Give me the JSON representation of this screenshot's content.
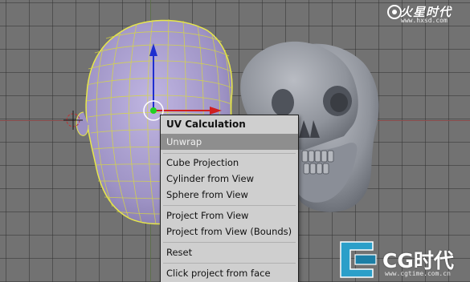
{
  "menu": {
    "title": "UV Calculation",
    "items": [
      {
        "label": "Unwrap",
        "active": true
      },
      {
        "label": "Cube Projection"
      },
      {
        "label": "Cylinder from View"
      },
      {
        "label": "Sphere from View"
      },
      {
        "label": "Project From View"
      },
      {
        "label": "Project from View (Bounds)"
      },
      {
        "label": "Reset"
      },
      {
        "label": "Click project from face"
      }
    ]
  },
  "watermark_top": {
    "brand": "火星时代",
    "url": "www.hxsd.com"
  },
  "watermark_bottom": {
    "brand": "CG时代",
    "url": "www.cgtime.com.cn"
  },
  "colors": {
    "viewport_bg": "#727272",
    "mesh_fill": "#a59cc4",
    "mesh_wire": "#e8e84a",
    "axis_z": "#1f2fd0",
    "axis_x": "#d01f1f",
    "skull": "#8a8e97",
    "menu_bg": "#cfcfcf",
    "menu_active": "#8e8e8e"
  }
}
